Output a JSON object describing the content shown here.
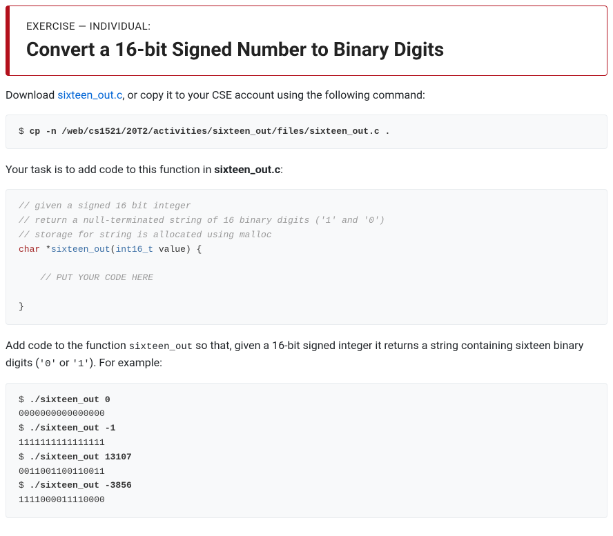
{
  "header": {
    "subtitle": "EXERCISE — INDIVIDUAL:",
    "title": "Convert a 16-bit Signed Number to Binary Digits"
  },
  "intro": {
    "prefix": "Download ",
    "link_text": "sixteen_out.c",
    "suffix": ", or copy it to your CSE account using the following command:"
  },
  "cp_cmd": {
    "prompt": "$ ",
    "cmd": "cp -n /web/cs1521/20T2/activities/sixteen_out/files/sixteen_out.c ."
  },
  "task_line": {
    "prefix": "Your task is to add code to this function in ",
    "filename": "sixteen_out.c",
    "suffix": ":"
  },
  "func_snippet": {
    "c1": "// given a signed 16 bit integer",
    "c2": "// return a null-terminated string of 16 binary digits ('1' and '0')",
    "c3": "// storage for string is allocated using malloc",
    "kw_char": "char",
    "star": " *",
    "fn_name": "sixteen_out",
    "paren_open": "(",
    "type": "int16_t",
    "arg": " value) {",
    "blank": "",
    "todo": "    // PUT YOUR CODE HERE",
    "close": "}"
  },
  "desc": {
    "t1": "Add code to the function ",
    "fn": "sixteen_out",
    "t2": " so that, given a 16-bit signed integer it returns a string containing sixteen binary digits (",
    "lit0": "'0'",
    "t3": " or ",
    "lit1": "'1'",
    "t4": "). For example:"
  },
  "examples": {
    "p1": "$ ",
    "c1": "./sixteen_out 0",
    "o1": "0000000000000000",
    "p2": "$ ",
    "c2": "./sixteen_out -1",
    "o2": "1111111111111111",
    "p3": "$ ",
    "c3": "./sixteen_out 13107",
    "o3": "0011001100110011",
    "p4": "$ ",
    "c4": "./sixteen_out -3856",
    "o4": "1111000011110000"
  }
}
